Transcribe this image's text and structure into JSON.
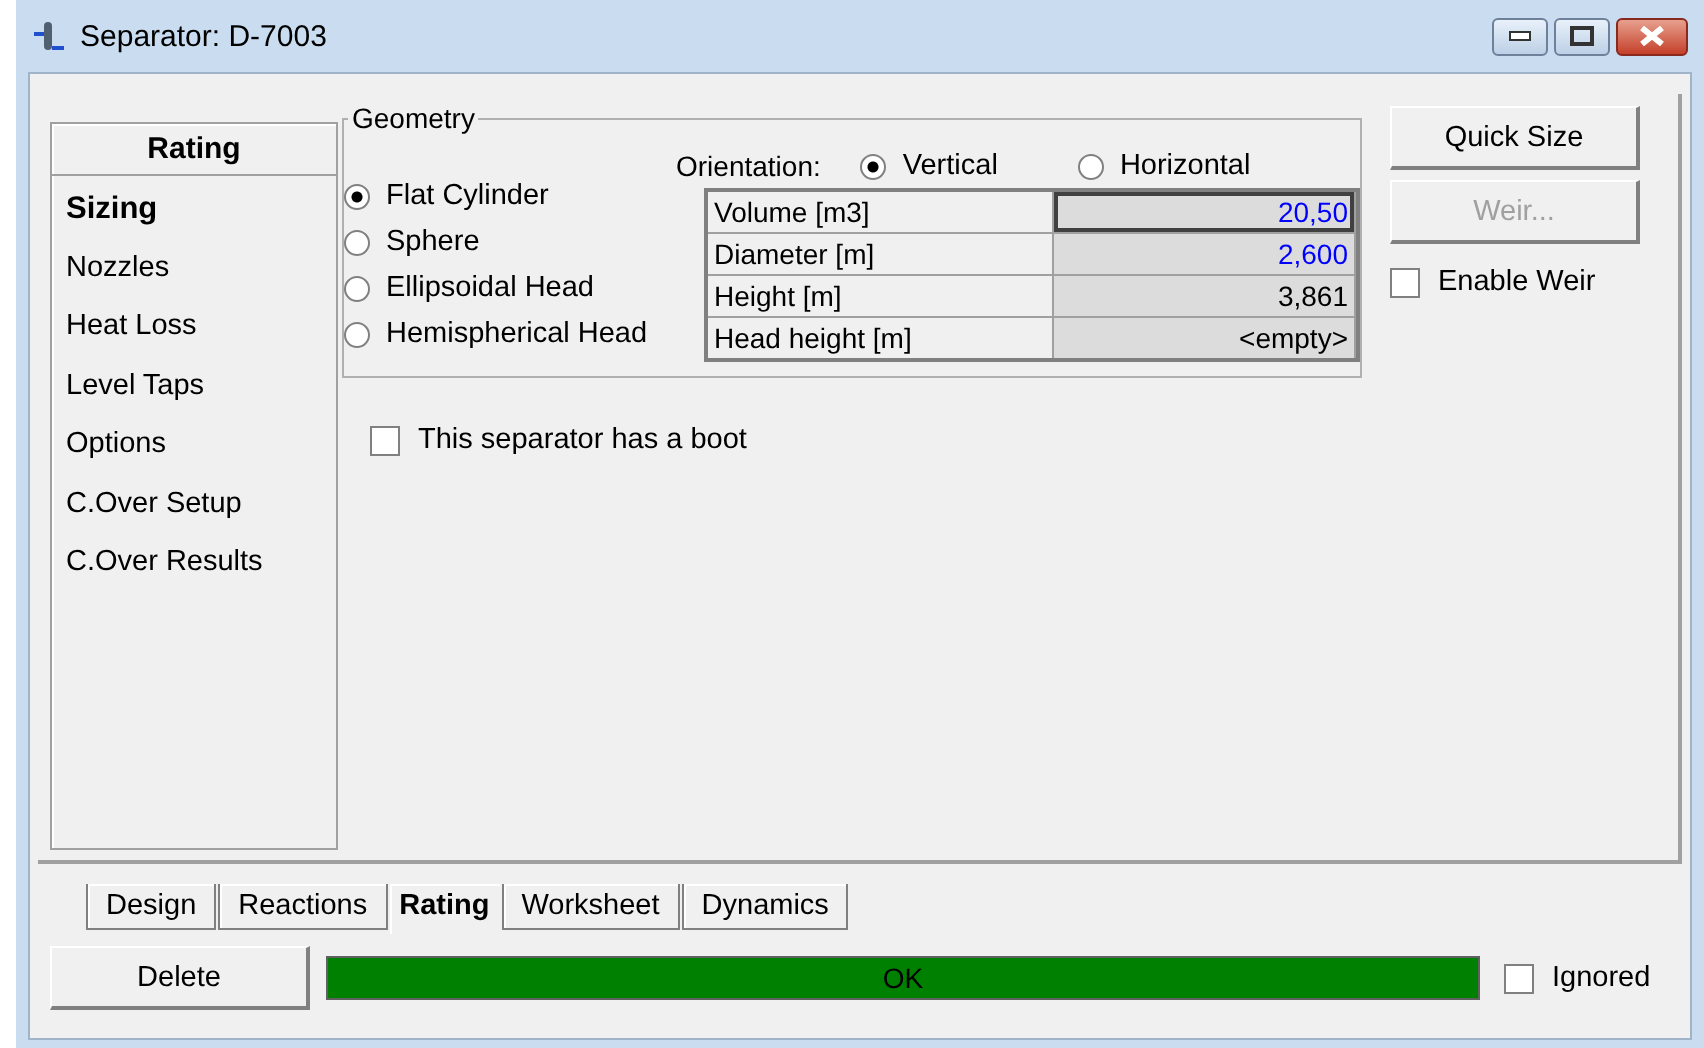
{
  "window": {
    "title": "Separator: D-7003"
  },
  "sidebar": {
    "title": "Rating",
    "items": [
      {
        "label": "Sizing",
        "selected": true
      },
      {
        "label": "Nozzles",
        "selected": false
      },
      {
        "label": "Heat Loss",
        "selected": false
      },
      {
        "label": "Level Taps",
        "selected": false
      },
      {
        "label": "Options",
        "selected": false
      },
      {
        "label": "C.Over Setup",
        "selected": false
      },
      {
        "label": "C.Over Results",
        "selected": false
      }
    ]
  },
  "geometry": {
    "title": "Geometry",
    "shapes": [
      {
        "label": "Flat Cylinder",
        "selected": true
      },
      {
        "label": "Sphere",
        "selected": false
      },
      {
        "label": "Ellipsoidal Head",
        "selected": false
      },
      {
        "label": "Hemispherical Head",
        "selected": false
      }
    ],
    "orientation_label": "Orientation:",
    "orientations": [
      {
        "label": "Vertical",
        "selected": true
      },
      {
        "label": "Horizontal",
        "selected": false
      }
    ],
    "table": [
      {
        "name": "Volume [m3]",
        "value": "20,50",
        "user_input": true,
        "focused": true
      },
      {
        "name": "Diameter [m]",
        "value": "2,600",
        "user_input": true,
        "focused": false
      },
      {
        "name": "Height [m]",
        "value": "3,861",
        "user_input": false,
        "focused": false
      },
      {
        "name": "Head height [m]",
        "value": "<empty>",
        "user_input": false,
        "focused": false
      }
    ]
  },
  "boot": {
    "label": "This separator has a boot",
    "checked": false
  },
  "buttons": [
    {
      "label": "Quick Size",
      "disabled": false
    },
    {
      "label": "Weir...",
      "disabled": true
    }
  ],
  "enable_weir": {
    "label": "Enable Weir",
    "checked": false
  },
  "tabs": [
    {
      "label": "Design",
      "selected": false
    },
    {
      "label": "Reactions",
      "selected": false
    },
    {
      "label": "Rating",
      "selected": true
    },
    {
      "label": "Worksheet",
      "selected": false
    },
    {
      "label": "Dynamics",
      "selected": false
    }
  ],
  "delete_button": "Delete",
  "status": {
    "text": "OK",
    "color": "#008000"
  },
  "ignored": {
    "label": "Ignored",
    "checked": false
  }
}
